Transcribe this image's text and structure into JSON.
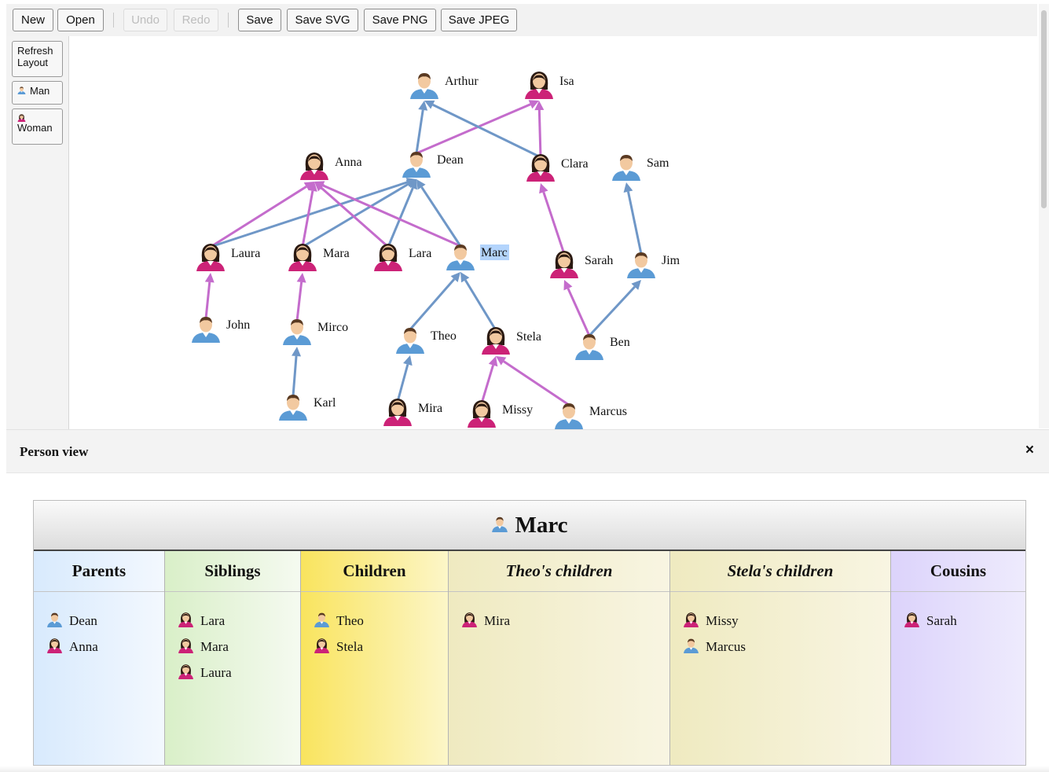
{
  "toolbar": {
    "new": "New",
    "open": "Open",
    "undo": "Undo",
    "redo": "Redo",
    "save": "Save",
    "save_svg": "Save SVG",
    "save_png": "Save PNG",
    "save_jpeg": "Save JPEG"
  },
  "palette": {
    "refresh": "Refresh Layout",
    "man": "Man",
    "woman": "Woman"
  },
  "graph": {
    "selected": "Marc",
    "colors": {
      "male_edge": "#6f97c7",
      "female_edge": "#c46ccc",
      "male_shirt": "#5b9bd5",
      "female_shirt": "#cc2277",
      "selection": "#b3d4fc"
    },
    "nodes": [
      {
        "id": "arthur",
        "label": "Arthur",
        "gender": "m"
      },
      {
        "id": "isa",
        "label": "Isa",
        "gender": "f"
      },
      {
        "id": "anna",
        "label": "Anna",
        "gender": "f"
      },
      {
        "id": "dean",
        "label": "Dean",
        "gender": "m"
      },
      {
        "id": "clara",
        "label": "Clara",
        "gender": "f"
      },
      {
        "id": "sam",
        "label": "Sam",
        "gender": "m"
      },
      {
        "id": "laura",
        "label": "Laura",
        "gender": "f"
      },
      {
        "id": "mara",
        "label": "Mara",
        "gender": "f"
      },
      {
        "id": "lara",
        "label": "Lara",
        "gender": "f"
      },
      {
        "id": "marc",
        "label": "Marc",
        "gender": "m"
      },
      {
        "id": "sarah",
        "label": "Sarah",
        "gender": "f"
      },
      {
        "id": "jim",
        "label": "Jim",
        "gender": "m"
      },
      {
        "id": "john",
        "label": "John",
        "gender": "m"
      },
      {
        "id": "mirco",
        "label": "Mirco",
        "gender": "m"
      },
      {
        "id": "theo",
        "label": "Theo",
        "gender": "m"
      },
      {
        "id": "stela",
        "label": "Stela",
        "gender": "f"
      },
      {
        "id": "ben",
        "label": "Ben",
        "gender": "m"
      },
      {
        "id": "karl",
        "label": "Karl",
        "gender": "m"
      },
      {
        "id": "mira",
        "label": "Mira",
        "gender": "f"
      },
      {
        "id": "missy",
        "label": "Missy",
        "gender": "f"
      },
      {
        "id": "marcus",
        "label": "Marcus",
        "gender": "m"
      }
    ],
    "edges": [
      {
        "from": "dean",
        "to": "arthur",
        "type": "m"
      },
      {
        "from": "dean",
        "to": "isa",
        "type": "f"
      },
      {
        "from": "clara",
        "to": "arthur",
        "type": "m"
      },
      {
        "from": "clara",
        "to": "isa",
        "type": "f"
      },
      {
        "from": "laura",
        "to": "anna",
        "type": "f"
      },
      {
        "from": "laura",
        "to": "dean",
        "type": "m"
      },
      {
        "from": "mara",
        "to": "anna",
        "type": "f"
      },
      {
        "from": "mara",
        "to": "dean",
        "type": "m"
      },
      {
        "from": "lara",
        "to": "anna",
        "type": "f"
      },
      {
        "from": "lara",
        "to": "dean",
        "type": "m"
      },
      {
        "from": "marc",
        "to": "anna",
        "type": "f"
      },
      {
        "from": "marc",
        "to": "dean",
        "type": "m"
      },
      {
        "from": "sarah",
        "to": "clara",
        "type": "f"
      },
      {
        "from": "jim",
        "to": "sam",
        "type": "m"
      },
      {
        "from": "john",
        "to": "laura",
        "type": "f"
      },
      {
        "from": "mirco",
        "to": "mara",
        "type": "f"
      },
      {
        "from": "theo",
        "to": "marc",
        "type": "m"
      },
      {
        "from": "stela",
        "to": "marc",
        "type": "m"
      },
      {
        "from": "ben",
        "to": "sarah",
        "type": "f"
      },
      {
        "from": "ben",
        "to": "jim",
        "type": "m"
      },
      {
        "from": "karl",
        "to": "mirco",
        "type": "m"
      },
      {
        "from": "mira",
        "to": "theo",
        "type": "m"
      },
      {
        "from": "missy",
        "to": "stela",
        "type": "f"
      },
      {
        "from": "marcus",
        "to": "stela",
        "type": "f"
      }
    ]
  },
  "person_view": {
    "title": "Person view",
    "close": "×",
    "person_name": "Marc",
    "person_gender": "m",
    "columns": [
      {
        "title": "Parents",
        "items": [
          {
            "name": "Dean",
            "gender": "m"
          },
          {
            "name": "Anna",
            "gender": "f"
          }
        ]
      },
      {
        "title": "Siblings",
        "items": [
          {
            "name": "Lara",
            "gender": "f"
          },
          {
            "name": "Mara",
            "gender": "f"
          },
          {
            "name": "Laura",
            "gender": "f"
          }
        ]
      },
      {
        "title": "Children",
        "items": [
          {
            "name": "Theo",
            "gender": "m"
          },
          {
            "name": "Stela",
            "gender": "f"
          }
        ]
      },
      {
        "title": "Theo's children",
        "items": [
          {
            "name": "Mira",
            "gender": "f"
          }
        ]
      },
      {
        "title": "Stela's children",
        "items": [
          {
            "name": "Missy",
            "gender": "f"
          },
          {
            "name": "Marcus",
            "gender": "m"
          }
        ]
      },
      {
        "title": "Cousins",
        "items": [
          {
            "name": "Sarah",
            "gender": "f"
          }
        ]
      }
    ]
  }
}
